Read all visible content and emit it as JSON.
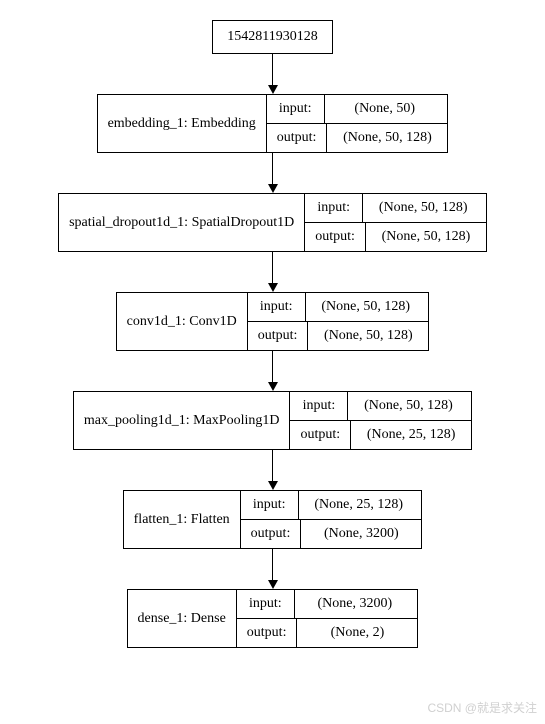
{
  "root": {
    "label": "1542811930128"
  },
  "layers": [
    {
      "name": "embedding_1: Embedding",
      "input": "(None, 50)",
      "output": "(None, 50, 128)"
    },
    {
      "name": "spatial_dropout1d_1: SpatialDropout1D",
      "input": "(None, 50, 128)",
      "output": "(None, 50, 128)"
    },
    {
      "name": "conv1d_1: Conv1D",
      "input": "(None, 50, 128)",
      "output": "(None, 50, 128)"
    },
    {
      "name": "max_pooling1d_1: MaxPooling1D",
      "input": "(None, 50, 128)",
      "output": "(None, 25, 128)"
    },
    {
      "name": "flatten_1: Flatten",
      "input": "(None, 25, 128)",
      "output": "(None, 3200)"
    },
    {
      "name": "dense_1: Dense",
      "input": "(None, 3200)",
      "output": "(None, 2)"
    }
  ],
  "labels": {
    "input": "input:",
    "output": "output:"
  },
  "watermark": "CSDN @就是求关注"
}
